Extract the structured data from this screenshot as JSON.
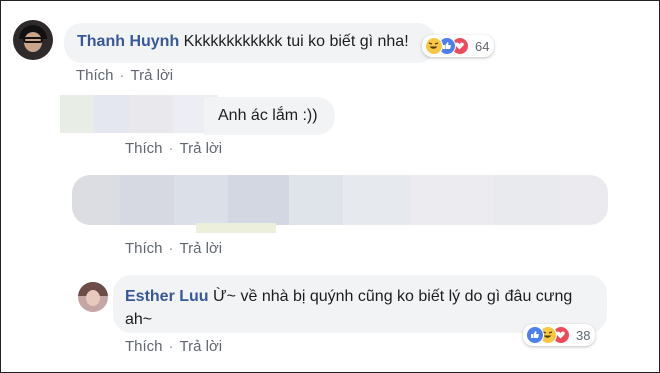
{
  "comments": [
    {
      "author": "Thanh Huynh",
      "text": "Kkkkkkkkkkkk tui ko biết gì nha!",
      "reaction_count": "64",
      "reaction_icons": [
        "haha-icon",
        "like-icon",
        "love-icon"
      ],
      "actions": [
        "Thích",
        "Trả lời"
      ]
    },
    {
      "author": "",
      "text": "Anh ác lắm :))",
      "actions": [
        "Thích",
        "Trả lời"
      ]
    },
    {
      "author": "",
      "text": "",
      "actions": [
        "Thích",
        "Trả lời"
      ]
    },
    {
      "author": "Esther Luu",
      "text_line1": "Ừ~ về nhà bị quýnh cũng ko biết lý do gì đâu cưng",
      "text_line2": "ah~",
      "reaction_count": "38",
      "reaction_icons": [
        "like-icon",
        "haha-icon",
        "love-icon"
      ],
      "actions": [
        "Thích",
        "Trả lời"
      ]
    }
  ],
  "separator": "·",
  "colors": {
    "name": "#385898",
    "bubble": "#f2f3f5",
    "action": "#606770",
    "like": "#4c7ff2",
    "love": "#ef4a5c",
    "haha": "#f7c843"
  }
}
